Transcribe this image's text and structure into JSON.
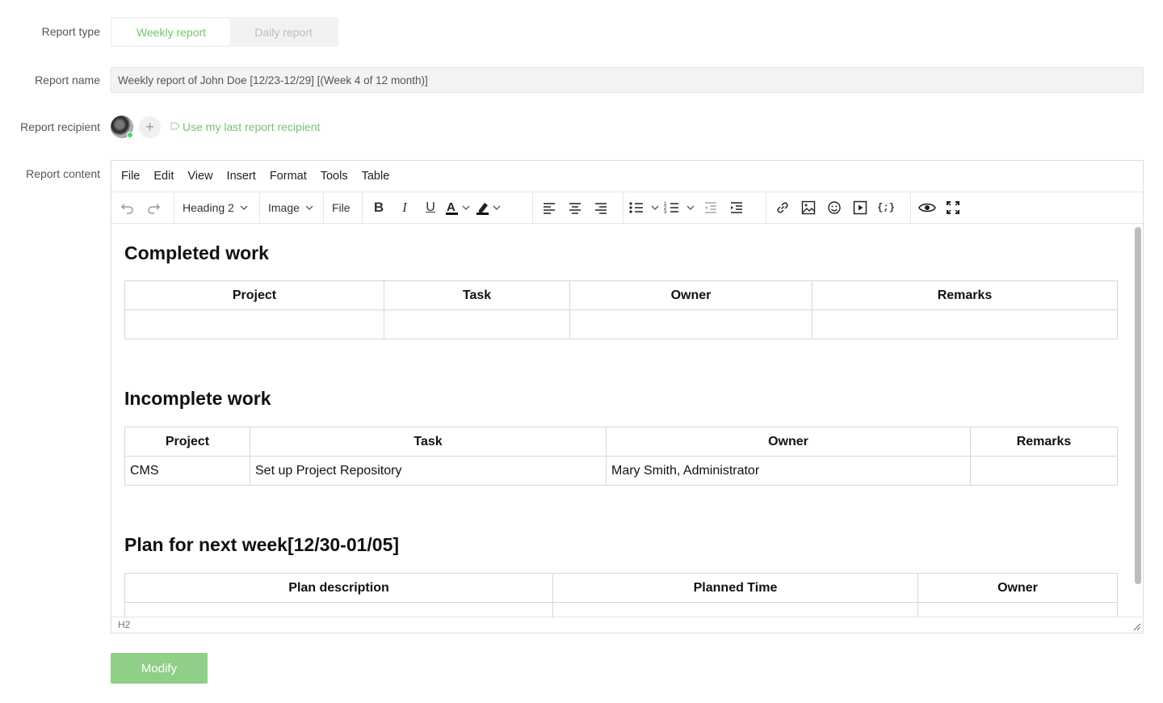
{
  "form": {
    "type_label": "Report type",
    "type_options": [
      "Weekly report",
      "Daily report"
    ],
    "name_label": "Report name",
    "name_value": "Weekly report of John Doe [12/23-12/29] [(Week 4 of 12 month)]",
    "recipient_label": "Report recipient",
    "recipient_add": "+",
    "recipient_last": "Use my last report recipient",
    "content_label": "Report content",
    "submit_label": "Modify"
  },
  "editor": {
    "menu": [
      "File",
      "Edit",
      "View",
      "Insert",
      "Format",
      "Tools",
      "Table"
    ],
    "toolbar": {
      "block_format": "Heading 2",
      "image_label": "Image",
      "file_label": "File"
    },
    "status_path": "H2"
  },
  "document": {
    "sections": [
      {
        "heading": "Completed work",
        "columns": [
          "Project",
          "Task",
          "Owner",
          "Remarks"
        ],
        "rows": [
          [
            "",
            "",
            "",
            ""
          ]
        ]
      },
      {
        "heading": "Incomplete work",
        "columns": [
          "Project",
          "Task",
          "Owner",
          "Remarks"
        ],
        "rows": [
          [
            "CMS",
            "Set up Project Repository",
            "Mary Smith, Administrator",
            ""
          ]
        ]
      },
      {
        "heading": "Plan for next week[12/30-01/05]",
        "columns": [
          "Plan description",
          "Planned Time",
          "Owner"
        ],
        "rows": [
          [
            "",
            "",
            ""
          ]
        ]
      }
    ]
  },
  "colors": {
    "accent": "#75c36f",
    "button": "#8fcf87"
  }
}
